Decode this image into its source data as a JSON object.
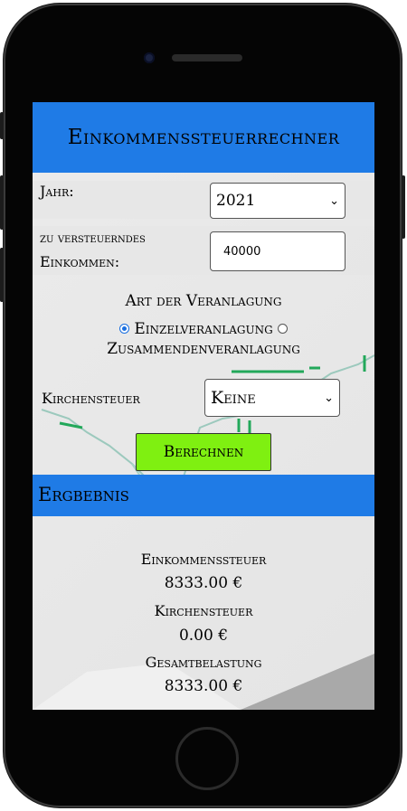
{
  "app": {
    "title": "Einkommenssteuerrechner"
  },
  "form": {
    "jahr_label": "Jahr:",
    "jahr_value": "2021",
    "income_label_line1": "zu versteuerndes",
    "income_label_line2": "Einkommen:",
    "income_value": "40000",
    "art_label": "Art der Veranlagung",
    "option_einzel": "Einzelveranlagung",
    "option_zusammen": "Zusammendenveranlagung",
    "selected_option": "Einzelveranlagung",
    "kirche_label": "Kirchensteuer",
    "kirche_value": "Keine",
    "submit_label": "Berechnen"
  },
  "result": {
    "header": "Ergbebnis",
    "income_tax_label": "Einkommenssteuer",
    "income_tax_value": "8333.00 €",
    "church_tax_label": "Kirchensteuer",
    "church_tax_value": "0.00 €",
    "total_label": "Gesamtbelastung",
    "total_value": "8333.00 €"
  },
  "colors": {
    "header_blue": "#1f7be6",
    "button_green": "#7ff011"
  }
}
